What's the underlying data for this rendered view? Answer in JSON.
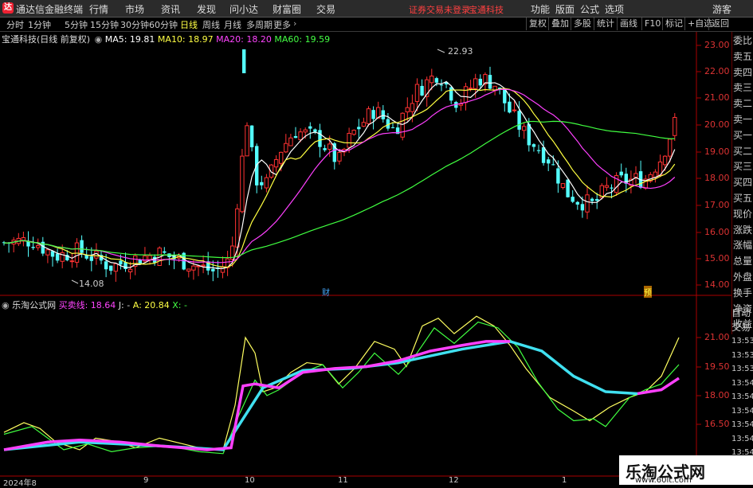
{
  "titlebar": {
    "app_name": "通达信金融终端",
    "menus": [
      "行情",
      "市场",
      "资讯",
      "发现",
      "问小达",
      "财富圈",
      "交易"
    ],
    "warning": "证券交易未登录",
    "stock": "宝通科技",
    "right_menus": [
      "功能",
      "版面",
      "公式",
      "选项"
    ],
    "guest": "游客"
  },
  "toolbar": {
    "periods": [
      "分时",
      "1分钟",
      "5分钟",
      "15分钟",
      "30分钟",
      "60分钟",
      "日线",
      "周线",
      "月线",
      "多周期",
      "更多"
    ],
    "active_period": "日线",
    "right_buttons": [
      "复权",
      "叠加",
      "多股",
      "统计",
      "画线",
      "F10",
      "标记",
      "+自选",
      "返回"
    ]
  },
  "main_info": {
    "title": "宝通科技(日线 前复权)",
    "ma5": "MA5: 19.81",
    "ma10": "MA10: 18.97",
    "ma20": "MA20: 18.20",
    "ma60": "MA60: 19.59",
    "colors": {
      "ma5": "#ffffff",
      "ma10": "#ffff40",
      "ma20": "#ff40ff",
      "ma60": "#40ff40"
    }
  },
  "sub_info": {
    "title": "乐淘公式网",
    "buy_sell": "买卖线: 18.64",
    "j": "J: -",
    "a": "A: 20.84",
    "x": "X: -"
  },
  "price_axis": [
    "23.00",
    "22.00",
    "21.00",
    "20.00",
    "19.00",
    "18.00",
    "17.00",
    "16.00",
    "15.00",
    "14.00"
  ],
  "sub_axis": [
    "21.00",
    "19.50",
    "18.00",
    "16.50"
  ],
  "annotations": {
    "high": "22.93",
    "low": "14.08",
    "marker1": "财",
    "marker2": "预"
  },
  "sidebar_items": [
    "委比",
    "卖五",
    "卖四",
    "卖三",
    "卖二",
    "卖一",
    "买一",
    "买二",
    "买三",
    "买四",
    "买五",
    "现价",
    "涨跌",
    "涨幅",
    "总量",
    "外盘",
    "换手",
    "净资",
    "收益"
  ],
  "sub_sidebar": [
    "自动",
    "交易"
  ],
  "time_axis": [
    "2024年8",
    "9",
    "10",
    "11",
    "12",
    "1"
  ],
  "right_times": [
    "13:53",
    "13:53",
    "13:53",
    "13:54",
    "13:54",
    "13:54",
    "13:54",
    "13:54",
    "13:54"
  ],
  "watermark": {
    "line1": "乐淘公式网",
    "line2": "www.60lt.com"
  }
}
